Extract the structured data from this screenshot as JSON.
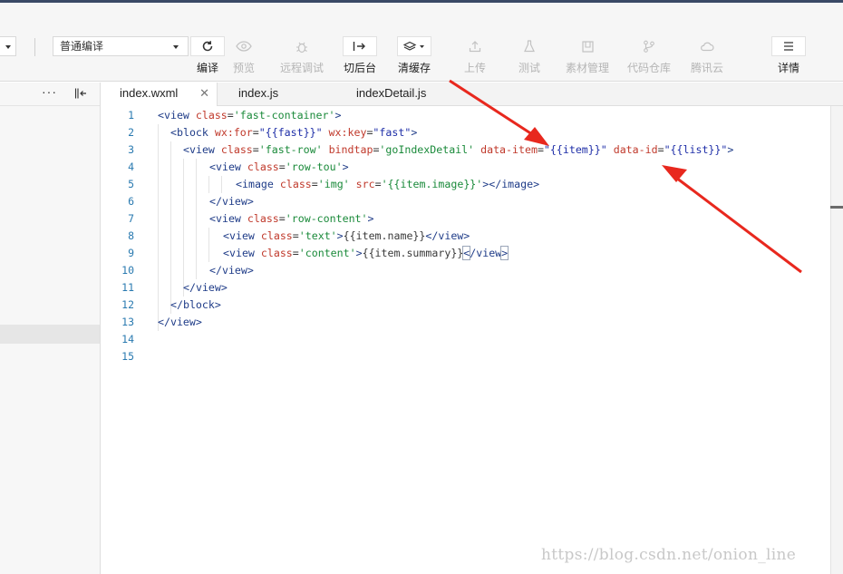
{
  "toolbar": {
    "compile_mode": "普通编译",
    "tools": [
      {
        "id": "compile",
        "label": "编译",
        "icon": "refresh-icon",
        "state": "active"
      },
      {
        "id": "preview",
        "label": "预览",
        "icon": "eye-icon",
        "state": "dim"
      },
      {
        "id": "remote-debug",
        "label": "远程调试",
        "icon": "bug-icon",
        "state": "dim"
      },
      {
        "id": "background",
        "label": "切后台",
        "icon": "switch-background-icon",
        "state": "active"
      },
      {
        "id": "clear-cache",
        "label": "清缓存",
        "icon": "layers-icon",
        "state": "active"
      },
      {
        "id": "upload",
        "label": "上传",
        "icon": "upload-icon",
        "state": "dim"
      },
      {
        "id": "test",
        "label": "测试",
        "icon": "flask-icon",
        "state": "dim"
      },
      {
        "id": "assets",
        "label": "素材管理",
        "icon": "image-icon",
        "state": "dim"
      },
      {
        "id": "repo",
        "label": "代码仓库",
        "icon": "branch-icon",
        "state": "dim"
      },
      {
        "id": "cloud",
        "label": "腾讯云",
        "icon": "cloud-icon",
        "state": "dim"
      },
      {
        "id": "details",
        "label": "详情",
        "icon": "menu-icon",
        "state": "active"
      }
    ]
  },
  "sidebar": {
    "more_glyph": "···"
  },
  "tabs": [
    {
      "label": "index.wxml",
      "active": true,
      "close_glyph": "✕"
    },
    {
      "label": "index.js",
      "active": false
    },
    {
      "label": "indexDetail.js",
      "active": false
    }
  ],
  "editor": {
    "line_numbers": [
      "1",
      "2",
      "3",
      "4",
      "5",
      "6",
      "7",
      "8",
      "9",
      "10",
      "11",
      "12",
      "13",
      "14",
      "15"
    ],
    "lines": {
      "l1": {
        "t1": "<view ",
        "a1": "class",
        "e1": "=",
        "s1": "'fast-container'",
        "t2": ">"
      },
      "l2": {
        "t1": "<block ",
        "a1": "wx:for",
        "e1": "=",
        "s1": "\"{{fast}}\"",
        "a2": " wx:key",
        "e2": "=",
        "s2": "\"fast\"",
        "t2": ">"
      },
      "l3": {
        "t1": "<view ",
        "a1": "class",
        "e1": "=",
        "s1": "'fast-row'",
        "a2": " bindtap",
        "e2": "=",
        "s2": "'goIndexDetail'",
        "a3": " data-item",
        "e3": "=",
        "b1": "\"{{item}}\"",
        "a4": " data-id",
        "e4": "=",
        "b2": "\"{{list}}\"",
        "t2": ">"
      },
      "l4": {
        "t1": "<view ",
        "a1": "class",
        "e1": "=",
        "s1": "'row-tou'",
        "t2": ">"
      },
      "l5": {
        "t1": "<image ",
        "a1": "class",
        "e1": "=",
        "s1": "'img'",
        "a2": " src",
        "e2": "=",
        "s2": "'{{item.image}}'",
        "t2": "></image>"
      },
      "l6": {
        "t1": "</view>"
      },
      "l7": {
        "t1": "<view ",
        "a1": "class",
        "e1": "=",
        "s1": "'row-content'",
        "t2": ">"
      },
      "l8": {
        "t1": "<view ",
        "a1": "class",
        "e1": "=",
        "s1": "'text'",
        "t2": ">",
        "x1": "{{item.name}}",
        "t3": "</view>"
      },
      "l9": {
        "t1": "<view ",
        "a1": "class",
        "e1": "=",
        "s1": "'content'",
        "t2": ">",
        "x1": "{{item.summary}}",
        "t3": "<",
        "t4": "/view",
        "t5": ">"
      },
      "l10": {
        "t1": "</view>"
      },
      "l11": {
        "t1": "</view>"
      },
      "l12": {
        "t1": "</block>"
      },
      "l13": {
        "t1": "</view>"
      }
    }
  },
  "watermark": "https://blog.csdn.net/onion_line",
  "colors": {
    "tag": "#1f3c88",
    "attribute": "#c0392b",
    "string": "#1a8a3a",
    "binding": "#1f2fa8",
    "line_number": "#2a7ab0",
    "annotation_arrow": "#e8281e"
  }
}
